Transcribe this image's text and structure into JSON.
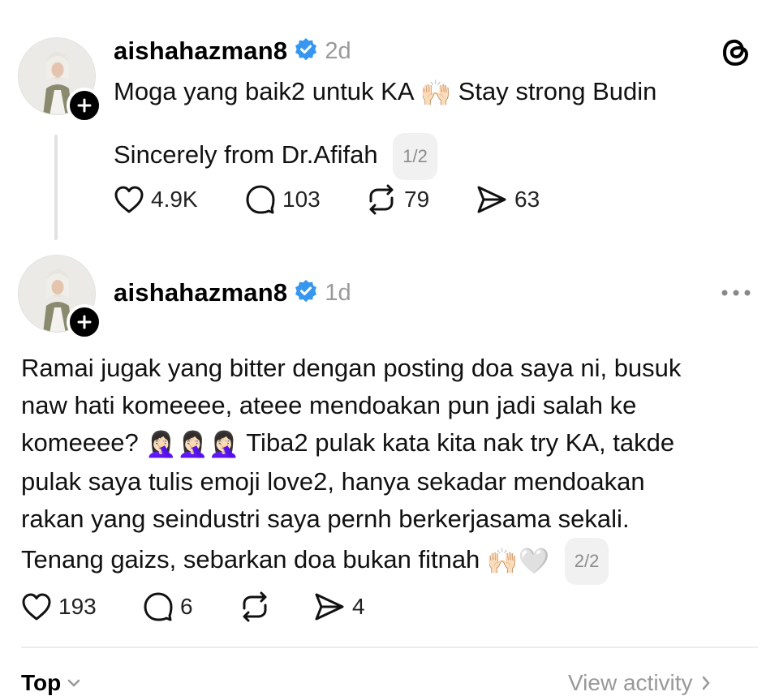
{
  "app": {
    "logo_icon": "threads-logo-icon"
  },
  "post1": {
    "username": "aishahazman8",
    "verified": true,
    "time": "2d",
    "line1_a": "Moga yang baik2 untuk KA",
    "line1_emoji": "🙌🏻",
    "line1_b": "Stay strong Budin",
    "line2": "Sincerely from Dr.Afifah",
    "counter": "1/2",
    "likes": "4.9K",
    "replies": "103",
    "reposts": "79",
    "shares": "63"
  },
  "post2": {
    "username": "aishahazman8",
    "verified": true,
    "time": "1d",
    "lines": [
      "Ramai jugak yang bitter dengan posting doa saya ni, busuk",
      "naw hati komeeee, ateee mendoakan pun jadi salah ke"
    ],
    "line3_a": "komeeee?",
    "line3_emojis": "🤦🏻‍♀️🤦🏻‍♀️🤦🏻‍♀️",
    "line3_b": "Tiba2 pulak kata kita nak try KA, takde",
    "line4": "pulak saya tulis emoji love2, hanya sekadar mendoakan",
    "line5": "rakan yang seindustri saya pernh berkerjasama sekali.",
    "line6": "Tenang gaizs, sebarkan doa bukan fitnah",
    "line6_emojis": "🙌🏻🤍",
    "counter": "2/2",
    "likes": "193",
    "replies": "6",
    "reposts": "",
    "shares": "4"
  },
  "footer": {
    "sort_label": "Top",
    "activity_label": "View activity"
  }
}
